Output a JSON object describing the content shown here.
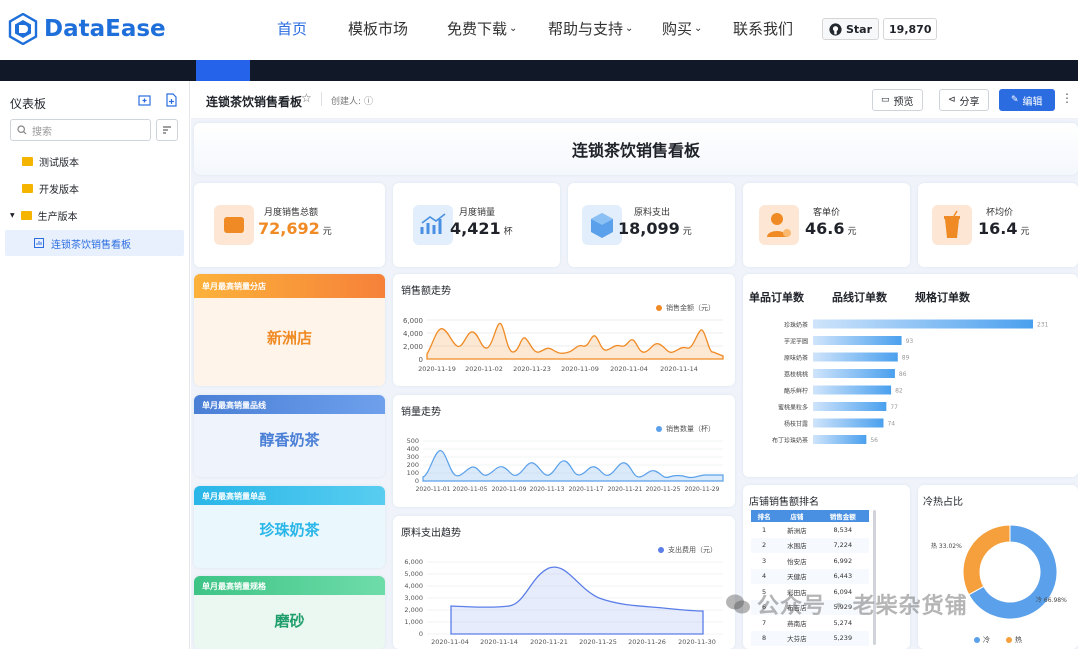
{
  "site": {
    "brand": "DataEase",
    "nav": [
      "首页",
      "模板市场",
      "免费下载",
      "帮助与支持",
      "购买",
      "联系我们"
    ],
    "github_star_label": "Star",
    "github_star_count": "19,870",
    "colors": {
      "brand": "#1e6fd9",
      "active_nav": "#2b6de0"
    }
  },
  "sidebar": {
    "title": "仪表板",
    "search_placeholder": "搜索",
    "items": [
      {
        "label": "测试版本"
      },
      {
        "label": "开发版本"
      },
      {
        "label": "生产版本"
      },
      {
        "label": "连锁茶饮销售看板"
      }
    ]
  },
  "header": {
    "dashboard_name": "连锁茶饮销售看板",
    "creator_label": "创建人:",
    "preview_label": "预览",
    "share_label": "分享",
    "edit_label": "编辑"
  },
  "dashboard": {
    "title": "连锁茶饮销售看板",
    "kpis": [
      {
        "label": "月度销售总额",
        "value": "72,692",
        "unit": "元",
        "color": "#f08a24"
      },
      {
        "label": "月度销量",
        "value": "4,421",
        "unit": "杯",
        "color": "#1f2329"
      },
      {
        "label": "原料支出",
        "value": "18,099",
        "unit": "元",
        "color": "#1f2329"
      },
      {
        "label": "客单价",
        "value": "46.6",
        "unit": "元",
        "color": "#1f2329"
      },
      {
        "label": "杯均价",
        "value": "16.4",
        "unit": "元",
        "color": "#1f2329"
      }
    ],
    "highlights": [
      {
        "header": "单月最高销量分店",
        "value": "新洲店",
        "color": "#f08a24"
      },
      {
        "header": "单月最高销量品线",
        "value": "醇香奶茶",
        "color": "#4a7fd6"
      },
      {
        "header": "单月最高销量单品",
        "value": "珍珠奶茶",
        "color": "#29b6e8"
      },
      {
        "header": "单月最高销量规格",
        "value": "磨砂",
        "color": "#1f9e6b"
      }
    ],
    "sales_trend": {
      "title": "销售额走势",
      "legend": "销售金额（元）",
      "y_ticks": [
        "6,000",
        "4,000",
        "2,000",
        "0"
      ],
      "x_ticks": [
        "2020-11-19",
        "2020-11-02",
        "2020-11-23",
        "2020-11-09",
        "2020-11-04",
        "2020-11-14"
      ]
    },
    "volume_trend": {
      "title": "销量走势",
      "legend": "销售数量（杯）",
      "y_ticks": [
        "500",
        "400",
        "300",
        "200",
        "100",
        "0"
      ],
      "x_ticks": [
        "2020-11-01",
        "2020-11-05",
        "2020-11-09",
        "2020-11-13",
        "2020-11-17",
        "2020-11-21",
        "2020-11-25",
        "2020-11-29"
      ]
    },
    "cost_trend": {
      "title": "原料支出趋势",
      "legend": "支出费用（元）",
      "y_ticks": [
        "6,000",
        "5,000",
        "4,000",
        "3,000",
        "2,000",
        "1,000",
        "0"
      ],
      "x_ticks": [
        "2020-11-04",
        "2020-11-14",
        "2020-11-21",
        "2020-11-25",
        "2020-11-26",
        "2020-11-30"
      ]
    },
    "order_tabs": [
      "单品订单数",
      "品线订单数",
      "规格订单数"
    ],
    "store_rank": {
      "title": "店铺销售额排名",
      "headers": [
        "排名",
        "店铺",
        "销售金额"
      ]
    },
    "hot_cold": {
      "title": "冷热占比",
      "hot_label": "热 33.02%",
      "cold_label": "冷 66.98%",
      "legend_cold": "冷",
      "legend_hot": "热"
    }
  },
  "chart_data": [
    {
      "type": "bar",
      "title": "单品订单数",
      "categories": [
        "珍珠奶茶",
        "芋泥芋圆",
        "原味奶茶",
        "荔枝桃桃",
        "酪乐鲜柠",
        "蜜桃果粒多",
        "杨枝甘露",
        "布丁珍珠奶茶"
      ],
      "values": [
        231,
        93,
        89,
        86,
        82,
        77,
        74,
        56
      ]
    },
    {
      "type": "table",
      "title": "店铺销售额排名",
      "rows": [
        [
          "1",
          "新洲店",
          "8,534"
        ],
        [
          "2",
          "水围店",
          "7,224"
        ],
        [
          "3",
          "怡安店",
          "6,992"
        ],
        [
          "4",
          "天健店",
          "6,443"
        ],
        [
          "5",
          "彩田店",
          "6,094"
        ],
        [
          "6",
          "布吉店",
          "5,929"
        ],
        [
          "7",
          "燕南店",
          "5,274"
        ],
        [
          "8",
          "大芬店",
          "5,239"
        ]
      ]
    },
    {
      "type": "pie",
      "title": "冷热占比",
      "categories": [
        "冷",
        "热"
      ],
      "values": [
        66.98,
        33.02
      ]
    }
  ],
  "watermark": "公众号 · 老柴杂货铺"
}
